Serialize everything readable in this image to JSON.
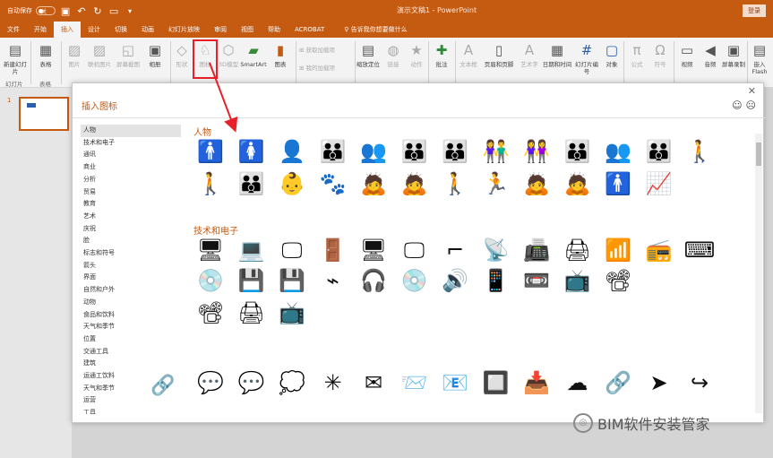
{
  "window": {
    "autosave_label": "自动保存",
    "autosave_state": "关",
    "title": "演示文稿1 - PowerPoint",
    "login_label": "登录",
    "qat_icons": [
      "save-icon",
      "undo-icon",
      "redo-icon",
      "slideshow-icon"
    ]
  },
  "tabs": [
    "文件",
    "开始",
    "插入",
    "设计",
    "切换",
    "动画",
    "幻灯片放映",
    "审阅",
    "视图",
    "帮助",
    "ACROBAT"
  ],
  "active_tab": "插入",
  "tell_me": "告诉我你想要做什么",
  "ribbon": {
    "new_slide": "新建幻灯片",
    "table": "表格",
    "picture": "图片",
    "online_picture": "联机图片",
    "screenshot": "屏幕截图",
    "album": "相册",
    "shapes": "形状",
    "icons": "图标",
    "model3d": "3D模型",
    "smartart": "SmartArt",
    "chart": "图表",
    "get_addins": "获取加载项",
    "my_addins": "我的加载项",
    "zoom": "缩放定位",
    "link": "链接",
    "action": "动作",
    "comment": "批注",
    "textbox": "文本框",
    "header_footer": "页眉和页脚",
    "wordart": "艺术字",
    "datetime": "日期和时间",
    "slide_number": "幻灯片编号",
    "object": "对象",
    "equation": "公式",
    "symbol": "符号",
    "video": "视频",
    "audio": "音频",
    "screen_record": "屏幕录制",
    "embed_flash": "嵌入Flash",
    "group_slides": "幻灯片",
    "group_tables": "表格"
  },
  "thumbnail": {
    "number": "1"
  },
  "dialog": {
    "title": "插入图标",
    "feedback_icons": [
      "smile-icon",
      "frown-icon"
    ],
    "categories": [
      "人物",
      "技术和电子",
      "通讯",
      "商业",
      "分析",
      "贸易",
      "教育",
      "艺术",
      "庆祝",
      "脸",
      "标志和符号",
      "箭头",
      "界面",
      "自然和户外",
      "动物",
      "食品和饮料",
      "天气和季节",
      "位置",
      "交通工具",
      "建筑",
      "运通工饮料",
      "天气和季节",
      "运营",
      "工具"
    ],
    "selected_category": "人物",
    "section_people": "人物",
    "section_tech": "技术和电子",
    "people_row1": [
      {
        "name": "man-icon",
        "glyph": "🚹"
      },
      {
        "name": "woman-icon",
        "glyph": "🚺"
      },
      {
        "name": "user-icon",
        "glyph": "👤"
      },
      {
        "name": "group-icon",
        "glyph": "👪"
      },
      {
        "name": "meeting-icon",
        "glyph": "👥"
      },
      {
        "name": "crowd-icon",
        "glyph": "👪"
      },
      {
        "name": "team-icon",
        "glyph": "👪"
      },
      {
        "name": "couple-icon",
        "glyph": "👫"
      },
      {
        "name": "couple-women-icon",
        "glyph": "👭"
      },
      {
        "name": "family-icon",
        "glyph": "👪"
      },
      {
        "name": "audience-icon",
        "glyph": "👥"
      },
      {
        "name": "people-row-icon",
        "glyph": "👪"
      },
      {
        "name": "parent-child-icon",
        "glyph": "🚶"
      }
    ],
    "people_row2": [
      {
        "name": "father-child-icon",
        "glyph": "🚶"
      },
      {
        "name": "family-walk-icon",
        "glyph": "👪"
      },
      {
        "name": "baby-icon",
        "glyph": "👶"
      },
      {
        "name": "crawling-baby-icon",
        "glyph": "🐾"
      },
      {
        "name": "caregiver-icon",
        "glyph": "🙇"
      },
      {
        "name": "crawl-icon",
        "glyph": "🙇"
      },
      {
        "name": "walking-icon",
        "glyph": "🚶"
      },
      {
        "name": "running-icon",
        "glyph": "🏃"
      },
      {
        "name": "nursing-icon",
        "glyph": "🙇"
      },
      {
        "name": "playing-icon",
        "glyph": "🙇"
      },
      {
        "name": "standing-icon",
        "glyph": "🚹"
      },
      {
        "name": "presentation-icon",
        "glyph": "📈"
      }
    ],
    "tech_row1": [
      {
        "name": "desktop-computer-icon",
        "glyph": "🖥"
      },
      {
        "name": "laptop-icon",
        "glyph": "💻"
      },
      {
        "name": "monitor-icon",
        "glyph": "🖵"
      },
      {
        "name": "security-gate-icon",
        "glyph": "🚪"
      },
      {
        "name": "screen-stand-icon",
        "glyph": "🖥"
      },
      {
        "name": "display-icon",
        "glyph": "🖵"
      },
      {
        "name": "frame-icon",
        "glyph": "⌐"
      },
      {
        "name": "router-antenna-icon",
        "glyph": "📡"
      },
      {
        "name": "fax-machine-icon",
        "glyph": "📠"
      },
      {
        "name": "scanner-icon",
        "glyph": "🖨"
      },
      {
        "name": "wifi-router-icon",
        "glyph": "📶"
      },
      {
        "name": "radio-icon",
        "glyph": "📻"
      },
      {
        "name": "typewriter-icon",
        "glyph": "⌨"
      }
    ],
    "tech_row2": [
      {
        "name": "cd-icon",
        "glyph": "💿"
      },
      {
        "name": "floppy-disk-icon",
        "glyph": "💾"
      },
      {
        "name": "floppy-disks-icon",
        "glyph": "💾"
      },
      {
        "name": "cable-icon",
        "glyph": "⌁"
      },
      {
        "name": "headphones-icon",
        "glyph": "🎧"
      },
      {
        "name": "vinyl-icon",
        "glyph": "💿"
      },
      {
        "name": "speakers-icon",
        "glyph": "🔊"
      },
      {
        "name": "remote-icon",
        "glyph": "📱"
      },
      {
        "name": "dvd-player-icon",
        "glyph": "📼"
      },
      {
        "name": "tv-icon",
        "glyph": "📺"
      },
      {
        "name": "projector-screen-icon",
        "glyph": "📽"
      }
    ],
    "tech_row3": [
      {
        "name": "projector-icon",
        "glyph": "📽"
      },
      {
        "name": "device-icon",
        "glyph": "🖨"
      },
      {
        "name": "flat-tv-icon",
        "glyph": "📺"
      }
    ],
    "comm_row1": [
      {
        "name": "speech-bubble-icon",
        "glyph": "💬"
      },
      {
        "name": "chat-icon",
        "glyph": "💬"
      },
      {
        "name": "thought-bubble-icon",
        "glyph": "💭"
      },
      {
        "name": "network-icon",
        "glyph": "✳"
      },
      {
        "name": "envelope-icon",
        "glyph": "✉"
      },
      {
        "name": "open-mail-icon",
        "glyph": "📨"
      },
      {
        "name": "email-at-icon",
        "glyph": "📧"
      },
      {
        "name": "stamp-icon",
        "glyph": "🔲"
      },
      {
        "name": "download-icon",
        "glyph": "📥"
      },
      {
        "name": "cloud-download-icon",
        "glyph": "☁"
      },
      {
        "name": "link-icon",
        "glyph": "🔗"
      },
      {
        "name": "paper-plane-icon",
        "glyph": "➤"
      },
      {
        "name": "share-icon",
        "glyph": "↪"
      }
    ],
    "link_side": {
      "name": "chain-link-icon",
      "glyph": "🔗"
    }
  },
  "watermark": "BIM软件安装管家"
}
